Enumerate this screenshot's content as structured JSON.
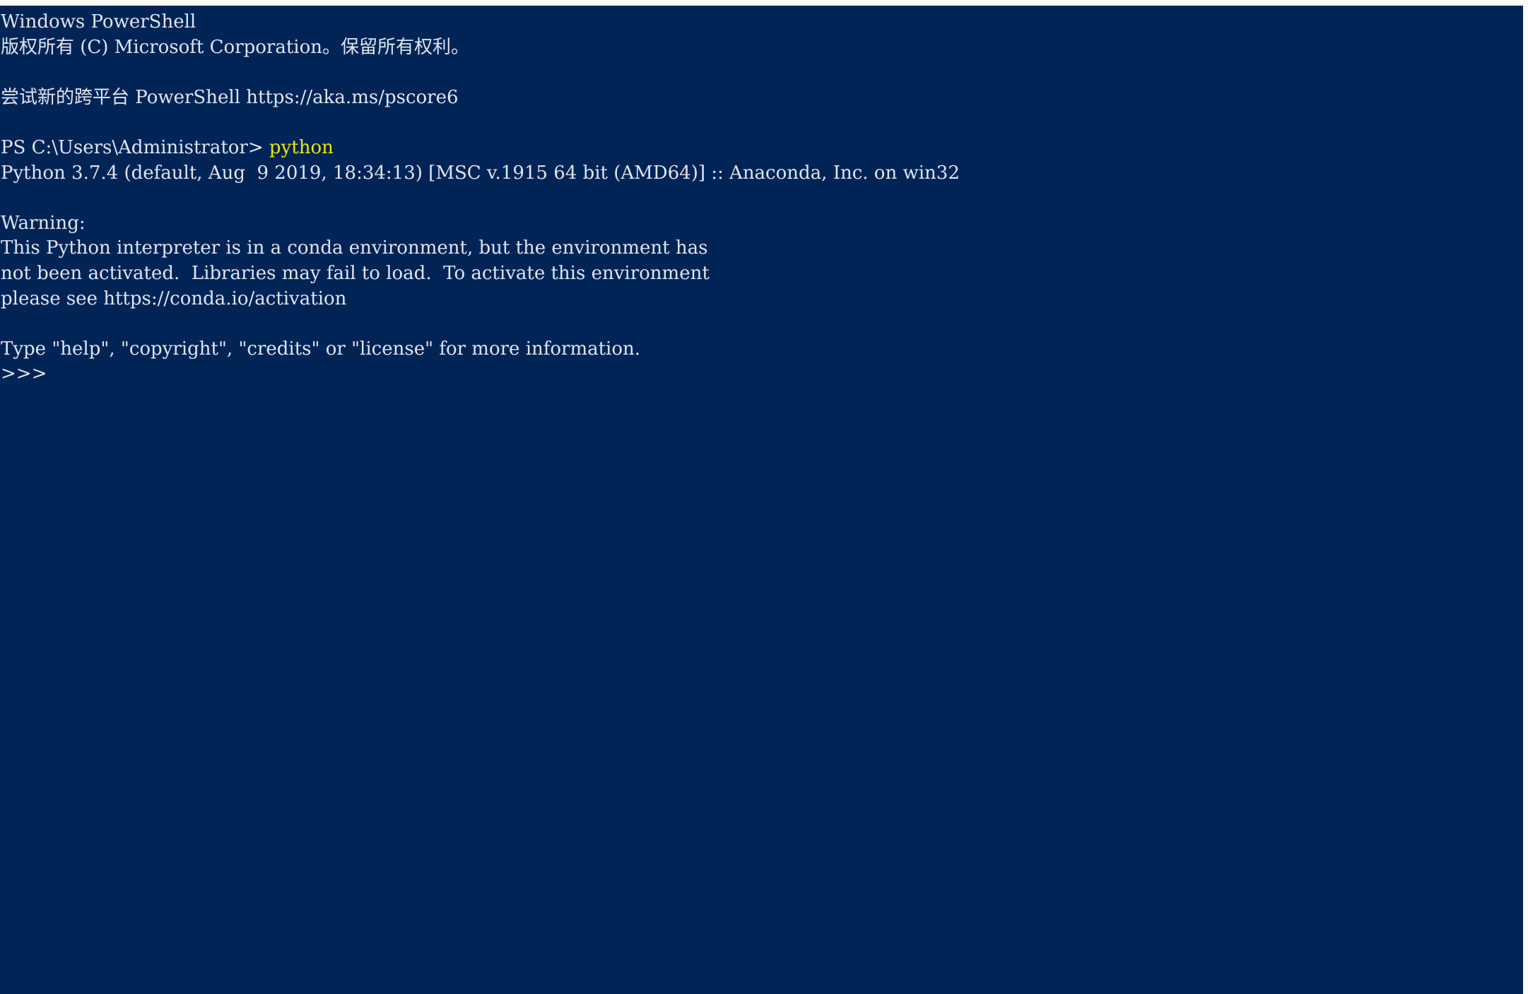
{
  "window": {
    "title": "Windows PowerShell",
    "background_color": "#012456",
    "foreground_color": "#dfe4ee",
    "command_color": "#e8e800",
    "trim_color": "#ffffff"
  },
  "console": {
    "lines": [
      {
        "id": "banner-title",
        "segments": [
          {
            "text": "Windows PowerShell",
            "style": "default"
          }
        ]
      },
      {
        "id": "banner-copyright",
        "segments": [
          {
            "text": "版权所有 (C) Microsoft Corporation。保留所有权利。",
            "style": "default"
          }
        ]
      },
      {
        "id": "blank-1",
        "segments": [
          {
            "text": " ",
            "style": "default"
          }
        ]
      },
      {
        "id": "banner-pscore-promo",
        "segments": [
          {
            "text": "尝试新的跨平台 PowerShell https://aka.ms/pscore6",
            "style": "default"
          }
        ]
      },
      {
        "id": "blank-2",
        "segments": [
          {
            "text": " ",
            "style": "default"
          }
        ]
      },
      {
        "id": "prompt-python",
        "segments": [
          {
            "text": "PS C:\\Users\\Administrator> ",
            "style": "prompt"
          },
          {
            "text": "python",
            "style": "command"
          }
        ]
      },
      {
        "id": "python-version",
        "segments": [
          {
            "text": "Python 3.7.4 (default, Aug  9 2019, 18:34:13) [MSC v.1915 64 bit (AMD64)] :: Anaconda, Inc. on win32",
            "style": "default"
          }
        ]
      },
      {
        "id": "blank-3",
        "segments": [
          {
            "text": " ",
            "style": "default"
          }
        ]
      },
      {
        "id": "warning-header",
        "segments": [
          {
            "text": "Warning:",
            "style": "default"
          }
        ]
      },
      {
        "id": "warning-body-1",
        "segments": [
          {
            "text": "This Python interpreter is in a conda environment, but the environment has",
            "style": "default"
          }
        ]
      },
      {
        "id": "warning-body-2",
        "segments": [
          {
            "text": "not been activated.  Libraries may fail to load.  To activate this environment",
            "style": "default"
          }
        ]
      },
      {
        "id": "warning-body-3",
        "segments": [
          {
            "text": "please see https://conda.io/activation",
            "style": "default"
          }
        ]
      },
      {
        "id": "blank-4",
        "segments": [
          {
            "text": " ",
            "style": "default"
          }
        ]
      },
      {
        "id": "python-help-hint",
        "segments": [
          {
            "text": "Type \"help\", \"copyright\", \"credits\" or \"license\" for more information.",
            "style": "default"
          }
        ]
      },
      {
        "id": "python-repl-prompt",
        "segments": [
          {
            "text": ">>>",
            "style": "default"
          }
        ]
      }
    ]
  }
}
